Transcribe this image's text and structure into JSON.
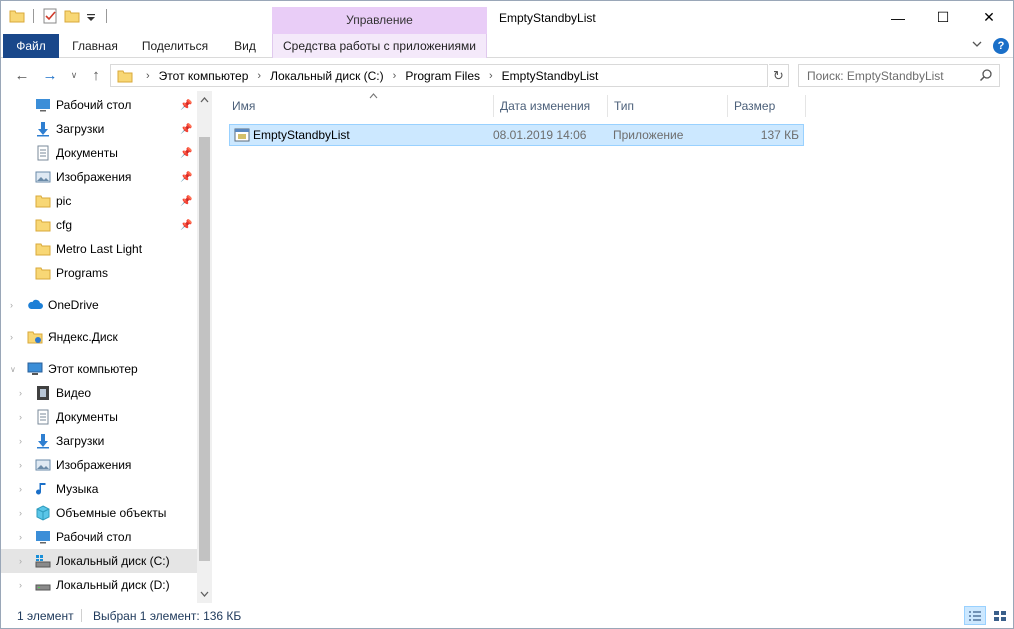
{
  "window": {
    "title": "EmptyStandbyList",
    "context_group_label": "Управление",
    "controls": {
      "minimize": "—",
      "maximize": "☐",
      "close": "✕"
    }
  },
  "ribbon": {
    "tabs": {
      "file": "Файл",
      "home": "Главная",
      "share": "Поделиться",
      "view": "Вид",
      "app_tools": "Средства работы с приложениями"
    },
    "collapse_icon": "chevron-down-icon",
    "help_label": "?"
  },
  "navigation": {
    "back_icon": "←",
    "forward_icon": "→",
    "recent_icon": "∨",
    "up_icon": "↑",
    "refresh_icon": "↻",
    "breadcrumbs": [
      "Этот компьютер",
      "Локальный диск (C:)",
      "Program Files",
      "EmptyStandbyList"
    ],
    "separator": "›",
    "search_placeholder": "Поиск: EmptyStandbyList"
  },
  "sidebar": {
    "quick_access": [
      {
        "label": "Рабочий стол",
        "icon": "desktop-icon",
        "pinned": true
      },
      {
        "label": "Загрузки",
        "icon": "downloads-icon",
        "pinned": true
      },
      {
        "label": "Документы",
        "icon": "documents-icon",
        "pinned": true
      },
      {
        "label": "Изображения",
        "icon": "pictures-icon",
        "pinned": true
      },
      {
        "label": "pic",
        "icon": "folder-icon",
        "pinned": true
      },
      {
        "label": "cfg",
        "icon": "folder-icon",
        "pinned": true
      },
      {
        "label": "Metro Last Light",
        "icon": "folder-icon",
        "pinned": false
      },
      {
        "label": "Programs",
        "icon": "folder-icon",
        "pinned": false
      }
    ],
    "onedrive": "OneDrive",
    "yandex_disk": "Яндекс.Диск",
    "this_pc": "Этот компьютер",
    "this_pc_items": [
      {
        "label": "Видео",
        "icon": "videos-icon"
      },
      {
        "label": "Документы",
        "icon": "documents-icon"
      },
      {
        "label": "Загрузки",
        "icon": "downloads-icon"
      },
      {
        "label": "Изображения",
        "icon": "pictures-icon"
      },
      {
        "label": "Музыка",
        "icon": "music-icon"
      },
      {
        "label": "Объемные объекты",
        "icon": "3d-objects-icon"
      },
      {
        "label": "Рабочий стол",
        "icon": "desktop-icon"
      },
      {
        "label": "Локальный диск (C:)",
        "icon": "drive-c-icon",
        "selected": true
      },
      {
        "label": "Локальный диск (D:)",
        "icon": "drive-d-icon"
      }
    ]
  },
  "file_list": {
    "columns": {
      "name": "Имя",
      "date": "Дата изменения",
      "type": "Тип",
      "size": "Размер"
    },
    "rows": [
      {
        "name": "EmptyStandbyList",
        "date": "08.01.2019 14:06",
        "type": "Приложение",
        "size": "137 КБ",
        "selected": true
      }
    ]
  },
  "status": {
    "count": "1 элемент",
    "selection": "Выбран 1 элемент: 136 КБ"
  },
  "colors": {
    "accent": "#19478a",
    "selection": "#cce8ff",
    "selection_border": "#99d1ff",
    "context_tab": "#e9cdf7",
    "folder": "#f8d775"
  }
}
